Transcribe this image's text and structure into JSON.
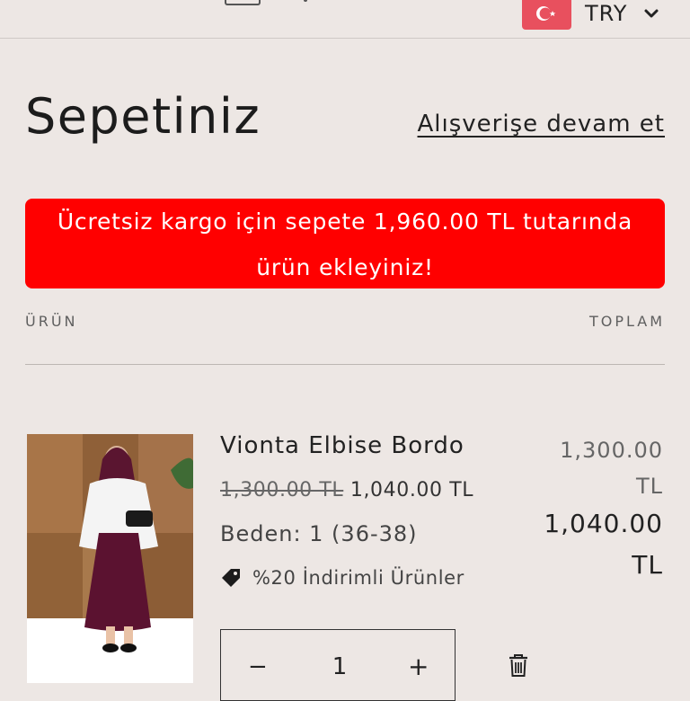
{
  "header": {
    "currency": "TRY"
  },
  "cart": {
    "title": "Sepetiniz",
    "continue_link": "Alışverişe devam et",
    "shipping_banner": {
      "line1": "Ücretsiz kargo için sepete 1,960.00 TL tutarında",
      "line2": "ürün ekleyiniz!"
    },
    "columns": {
      "product": "ÜRÜN",
      "total": "TOPLAM"
    },
    "item": {
      "name": "Vionta Elbise Bordo",
      "original_price": "1,300.00 TL",
      "sale_price": "1,040.00 TL",
      "size": "Beden: 1 (36-38)",
      "discount_label": "%20 İndirimli Ürünler",
      "total_original_amount": "1,300.00",
      "total_original_currency": "TL",
      "total_final_amount": "1,040.00",
      "total_final_currency": "TL",
      "quantity": "1",
      "minus": "−",
      "plus": "+"
    }
  },
  "colors": {
    "background": "#ede7e4",
    "banner": "#ff0000",
    "flag": "#e8505e"
  }
}
